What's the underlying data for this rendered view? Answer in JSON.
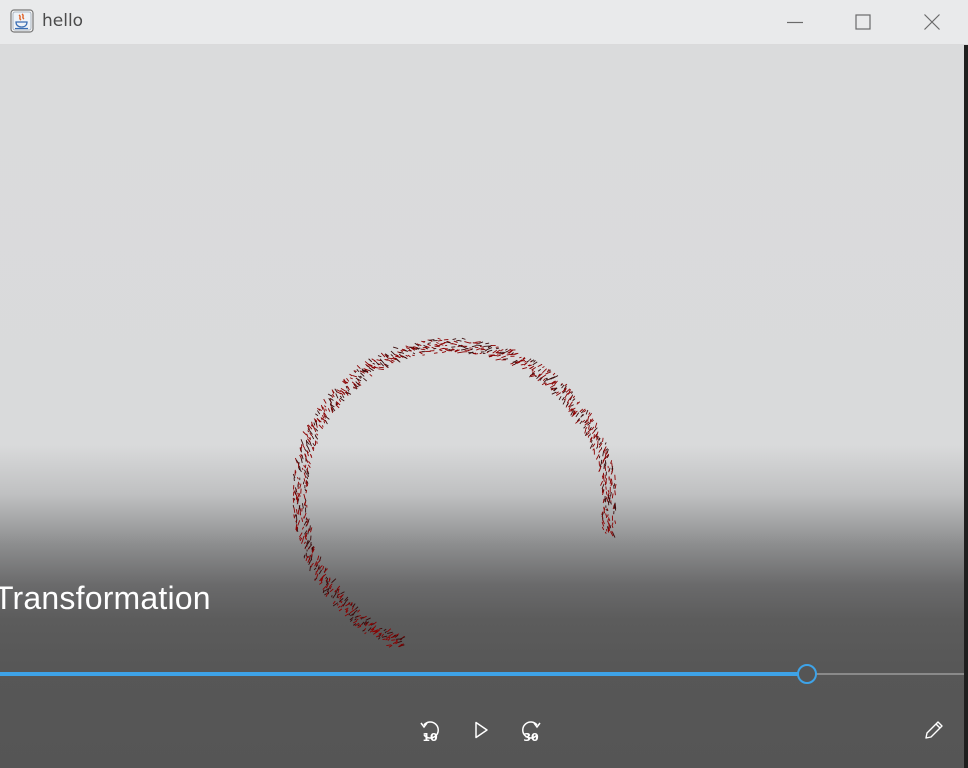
{
  "window": {
    "title": "hello",
    "icon": "java-coffee-icon",
    "controls": [
      "minimize-icon",
      "maximize-icon",
      "close-icon"
    ]
  },
  "player": {
    "video_title": "Transformation",
    "progress": 0.836,
    "rewind_seconds": "10",
    "forward_seconds": "30",
    "accent_color": "#3ea3e8",
    "stroke_color": "#8b0000"
  }
}
